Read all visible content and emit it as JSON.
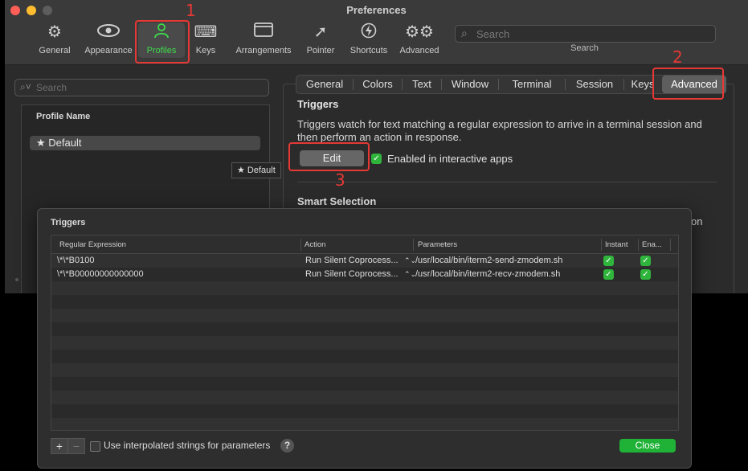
{
  "window": {
    "title": "Preferences"
  },
  "toolbar": {
    "items": [
      {
        "label": "General",
        "icon": "gear-icon"
      },
      {
        "label": "Appearance",
        "icon": "eye-icon"
      },
      {
        "label": "Profiles",
        "icon": "person-icon"
      },
      {
        "label": "Keys",
        "icon": "keyboard-icon"
      },
      {
        "label": "Arrangements",
        "icon": "window-icon"
      },
      {
        "label": "Pointer",
        "icon": "pointer-icon"
      },
      {
        "label": "Shortcuts",
        "icon": "bolt-icon"
      },
      {
        "label": "Advanced",
        "icon": "gears-icon"
      }
    ],
    "search_placeholder": "Search",
    "search_label": "Search"
  },
  "annotations": {
    "n1": "1",
    "n2": "2",
    "n3": "3"
  },
  "left": {
    "search_placeholder": "Search",
    "header": "Profile Name",
    "profile": "★ Default",
    "drag_tag": "★ Default"
  },
  "tabs": [
    "General",
    "Colors",
    "Text",
    "Window",
    "Terminal",
    "Session",
    "Keys",
    "Advanced"
  ],
  "triggers_section": {
    "title": "Triggers",
    "description": "Triggers watch for text matching a regular expression to arrive in a terminal session and then perform an action in response.",
    "edit_label": "Edit",
    "enabled_label": "Enabled in interactive apps"
  },
  "smart_selection": {
    "title": "Smart Selection",
    "fragment": "on"
  },
  "sheet": {
    "title": "Triggers",
    "columns": [
      "Regular Expression",
      "Action",
      "Parameters",
      "Instant",
      "Ena..."
    ],
    "rows": [
      {
        "regex": "\\*\\*B0100",
        "action": "Run Silent Coprocess...",
        "params": "/usr/local/bin/iterm2-send-zmodem.sh",
        "instant": true,
        "enabled": true
      },
      {
        "regex": "\\*\\*B00000000000000",
        "action": "Run Silent Coprocess...",
        "params": "/usr/local/bin/iterm2-recv-zmodem.sh",
        "instant": true,
        "enabled": true
      }
    ],
    "add_label": "+",
    "remove_label": "−",
    "interp_label": "Use interpolated strings for parameters",
    "help_label": "?",
    "close_label": "Close"
  },
  "colors": {
    "accent_green": "#3ddc4c",
    "highlight_red": "#e53935",
    "close_green": "#1fb236"
  }
}
